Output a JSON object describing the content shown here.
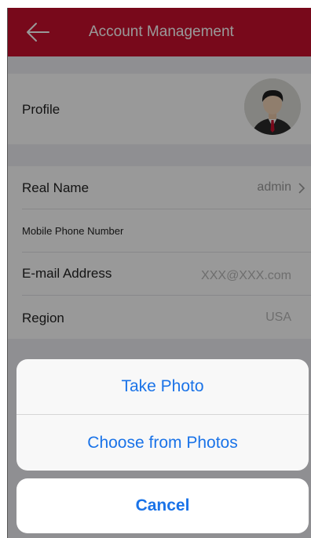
{
  "header": {
    "title": "Account Management",
    "back_icon": "back-arrow-icon",
    "background": "#c8102e"
  },
  "profile": {
    "label": "Profile",
    "avatar_icon": "user-avatar-icon"
  },
  "fields": {
    "real_name_label": "Real Name",
    "real_name_value": "admin",
    "mobile_label": "Mobile Phone Number",
    "email_label": "E-mail Address",
    "email_placeholder": "XXX@XXX.com",
    "region_label": "Region",
    "region_value": "USA"
  },
  "action_sheet": {
    "take_photo": "Take Photo",
    "choose_photos": "Choose from Photos",
    "cancel": "Cancel",
    "accent": "#1a73e8"
  }
}
